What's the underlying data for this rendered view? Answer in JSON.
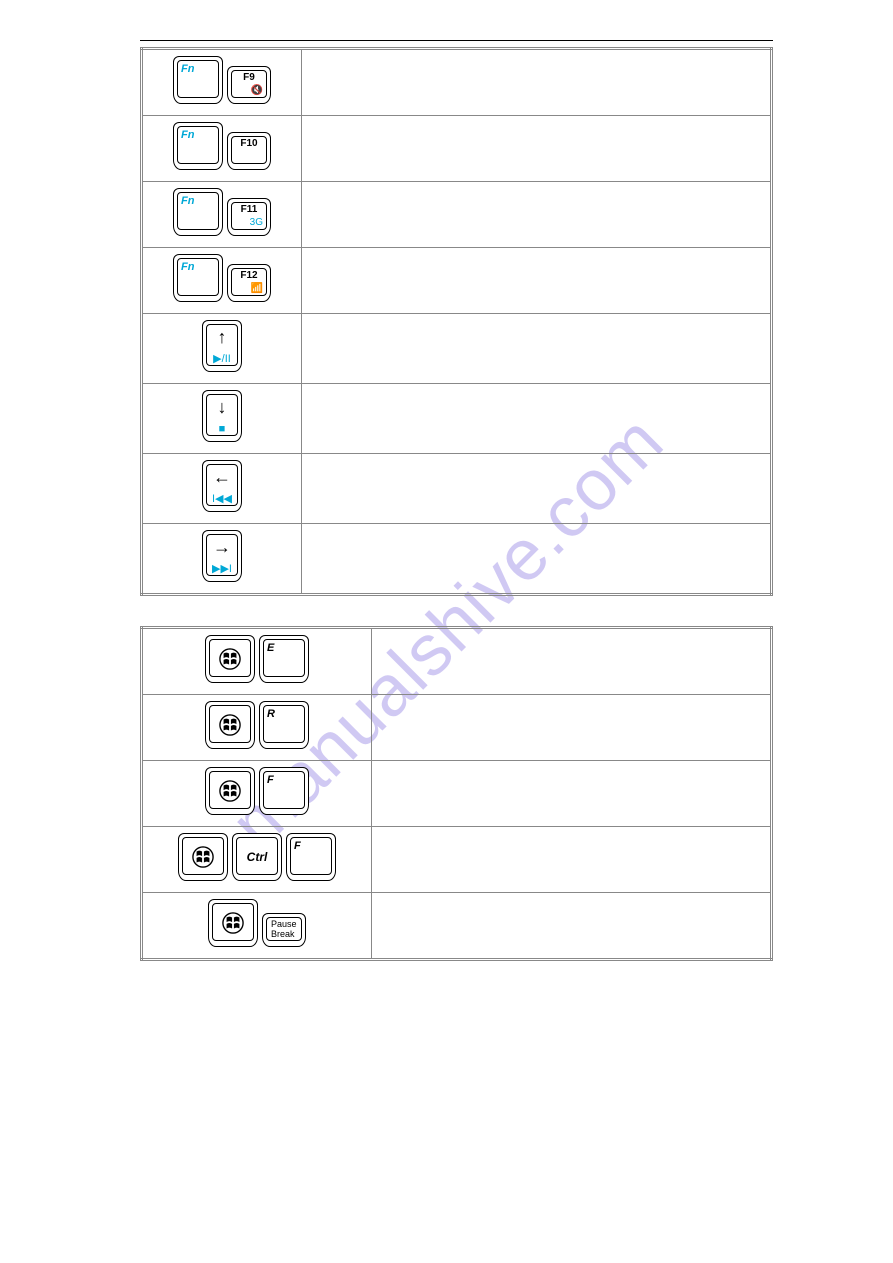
{
  "watermark": "manualshive.com",
  "table1": {
    "rows": [
      {
        "left_keys": [
          {
            "size": "big",
            "tl": "Fn",
            "tl_color": "cyan"
          },
          {
            "size": "med",
            "tc": "F9",
            "br": "🔇",
            "br_color": "cyan"
          }
        ]
      },
      {
        "left_keys": [
          {
            "size": "big",
            "tl": "Fn",
            "tl_color": "cyan"
          },
          {
            "size": "med",
            "tc": "F10"
          }
        ]
      },
      {
        "left_keys": [
          {
            "size": "big",
            "tl": "Fn",
            "tl_color": "cyan"
          },
          {
            "size": "med",
            "tc": "F11",
            "br": "3G",
            "br_color": "cyan"
          }
        ]
      },
      {
        "left_keys": [
          {
            "size": "big",
            "tl": "Fn",
            "tl_color": "cyan"
          },
          {
            "size": "med",
            "tc": "F12",
            "br": "📶",
            "br_color": "cyan"
          }
        ]
      },
      {
        "left_keys": [
          {
            "size": "tall",
            "arrow": "↑",
            "bc": "▶/II",
            "bc_color": "cyan"
          }
        ]
      },
      {
        "left_keys": [
          {
            "size": "tall",
            "arrow": "↓",
            "bc": "■",
            "bc_color": "cyan"
          }
        ]
      },
      {
        "left_keys": [
          {
            "size": "tall",
            "arrow": "←",
            "bc": "I◀◀",
            "bc_color": "cyan"
          }
        ]
      },
      {
        "left_keys": [
          {
            "size": "tall",
            "arrow": "→",
            "bc": "▶▶I",
            "bc_color": "cyan"
          }
        ]
      }
    ]
  },
  "table2": {
    "rows": [
      {
        "left_keys": [
          {
            "size": "big",
            "win": true
          },
          {
            "size": "big",
            "tl": "E"
          }
        ]
      },
      {
        "left_keys": [
          {
            "size": "big",
            "win": true
          },
          {
            "size": "big",
            "tl": "R"
          }
        ]
      },
      {
        "left_keys": [
          {
            "size": "big",
            "win": true
          },
          {
            "size": "big",
            "tl": "F"
          }
        ]
      },
      {
        "left_keys": [
          {
            "size": "big",
            "win": true
          },
          {
            "size": "big",
            "c": "Ctrl"
          },
          {
            "size": "big",
            "tl": "F"
          }
        ]
      },
      {
        "left_keys": [
          {
            "size": "big",
            "win": true
          },
          {
            "size": "thin",
            "ml": "Pause\nBreak"
          }
        ]
      }
    ]
  }
}
